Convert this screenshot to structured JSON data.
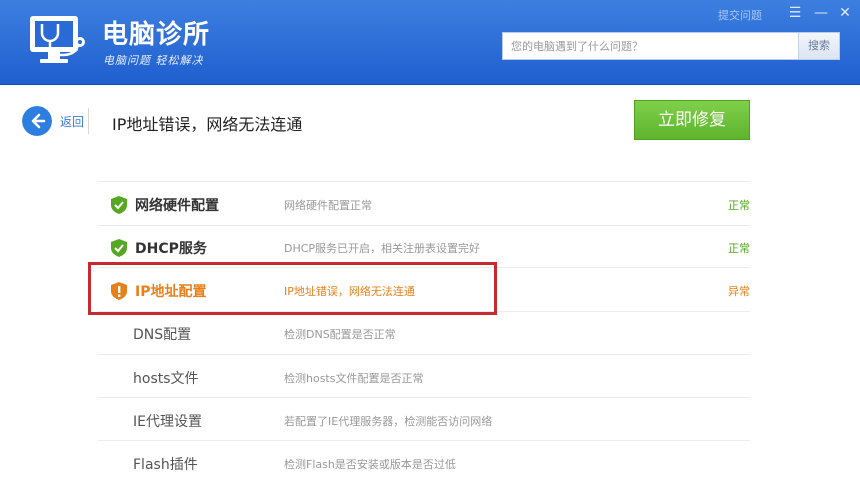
{
  "header": {
    "title": "电脑诊所",
    "slogan": "电脑问题 轻松解决",
    "feedback_link": "提交问题",
    "icons": {
      "logo": "monitor-stethoscope-icon",
      "menu": "menu-icon",
      "minimize": "minimize-icon",
      "close": "close-icon"
    },
    "colors": {
      "background": "#2a6ad6"
    }
  },
  "search": {
    "placeholder": "您的电脑遇到了什么问题？",
    "button_label": "搜索"
  },
  "nav": {
    "back_label": "返回",
    "back_icon": "arrow-left-icon"
  },
  "page": {
    "title": "IP地址错误，网络无法连通",
    "fix_button": "立即修复",
    "fix_button_color": "#6cc13a"
  },
  "checks": [
    {
      "name": "网络硬件配置",
      "description": "网络硬件配置正常",
      "status": "正常",
      "icon": "shield-check-icon"
    },
    {
      "name": "DHCP服务",
      "description": "DHCP服务已开启，相关注册表设置完好",
      "status": "正常",
      "icon": "shield-check-icon"
    },
    {
      "name": "IP地址配置",
      "description": "IP地址错误，网络无法连通",
      "status": "异常",
      "icon": "shield-warning-icon"
    },
    {
      "name": "DNS配置",
      "description": "检测DNS配置是否正常"
    },
    {
      "name": "hosts文件",
      "description": "检测hosts文件配置是否正常"
    },
    {
      "name": "IE代理设置",
      "description": "若配置了IE代理服务器，检测能否访问网络"
    },
    {
      "name": "Flash插件",
      "description": "检测Flash是否安装或版本是否过低"
    }
  ],
  "status_colors": {
    "ok": "#56a822",
    "error": "#e8801a",
    "highlight": "#c62a30"
  }
}
